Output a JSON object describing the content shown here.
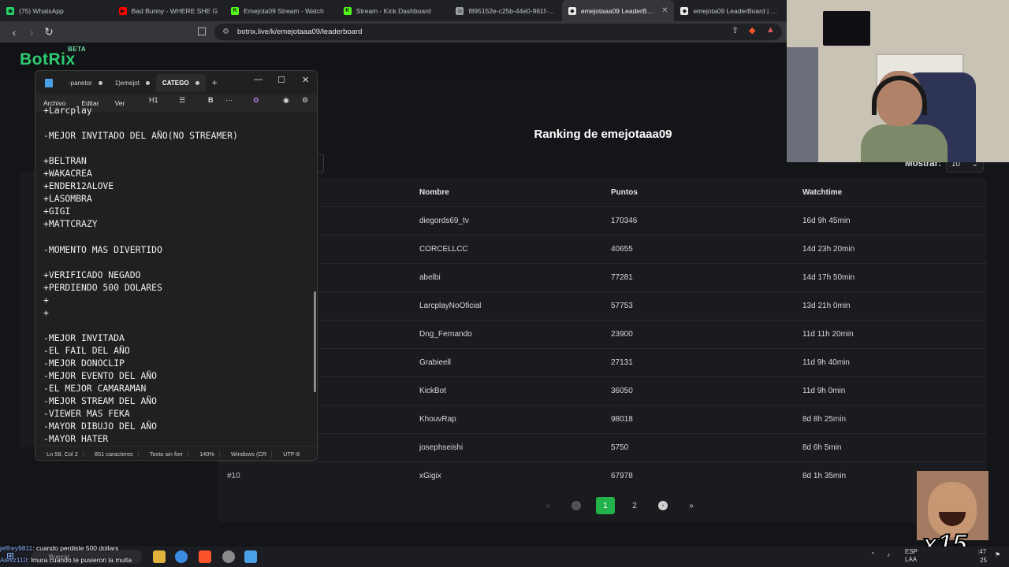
{
  "browser": {
    "tabs": [
      {
        "title": "(75) WhatsApp",
        "icon": "whatsapp-icon",
        "color": "#25d366",
        "glyph": "◉"
      },
      {
        "title": "Bad Bunny - WHERE SHE G",
        "icon": "youtube-icon",
        "color": "#ff0000",
        "glyph": "▶"
      },
      {
        "title": "Emejota09 Stream - Watch",
        "icon": "kick-icon",
        "color": "#53fc18",
        "glyph": "K"
      },
      {
        "title": "Stream - Kick Dashboard",
        "icon": "kick-icon",
        "color": "#53fc18",
        "glyph": "K"
      },
      {
        "title": "f895152e-c25b-44e0-961f-322",
        "icon": "globe-icon",
        "color": "#9aa0a6",
        "glyph": "◎"
      },
      {
        "title": "emejotaaa09 LeaderBoard",
        "icon": "botrix-icon",
        "color": "#e8e8e8",
        "glyph": "◆",
        "active": true
      },
      {
        "title": "emejota09 LeaderBoard | The",
        "icon": "botrix-icon",
        "color": "#e8e8e8",
        "glyph": "◆"
      }
    ],
    "url": "botrix.live/k/emejotaaa09/leaderboard"
  },
  "site": {
    "logo": "BotRix",
    "beta": "BETA",
    "ranking_title": "Ranking de emejotaaa09",
    "show_label": "Mostrar:",
    "show_value": "10",
    "columns": {
      "name": "Nombre",
      "points": "Puntos",
      "watchtime": "Watchtime"
    },
    "rows": [
      {
        "rank": "",
        "name": "diegords69_tv",
        "points": "170346",
        "watchtime": "16d 9h 45min"
      },
      {
        "rank": "",
        "name": "CORCELLCC",
        "points": "40655",
        "watchtime": "14d 23h 20min"
      },
      {
        "rank": "",
        "name": "abelbi",
        "points": "77281",
        "watchtime": "14d 17h 50min"
      },
      {
        "rank": "",
        "name": "LarcplayNoOficial",
        "points": "57753",
        "watchtime": "13d 21h 0min"
      },
      {
        "rank": "",
        "name": "Dng_Fernando",
        "points": "23900",
        "watchtime": "11d 11h 20min"
      },
      {
        "rank": "",
        "name": "Grabieell",
        "points": "27131",
        "watchtime": "11d 9h 40min"
      },
      {
        "rank": "",
        "name": "KickBot",
        "points": "36050",
        "watchtime": "11d 9h 0min"
      },
      {
        "rank": "",
        "name": "KhouvRap",
        "points": "98018",
        "watchtime": "8d 8h 25min"
      },
      {
        "rank": "",
        "name": "josephseishi",
        "points": "5750",
        "watchtime": "8d 6h 5min"
      },
      {
        "rank": "#10",
        "name": "xGigix",
        "points": "67978",
        "watchtime": "8d 1h 35min"
      }
    ],
    "pagination": {
      "first": "«",
      "prev": "‹",
      "page1": "1",
      "page2": "2",
      "next": "›",
      "last": "»"
    }
  },
  "notepad": {
    "tabs": [
      "-panetor",
      "1)emejot",
      "CATEGO"
    ],
    "menu": [
      "Archivo",
      "Editar",
      "Ver"
    ],
    "heading": "H1",
    "bold": "B",
    "more": "···",
    "text": "+Larcplay\n\n-MEJOR INVITADO DEL AÑO(NO STREAMER)\n\n+BELTRAN\n+WAKACREA\n+ENDER12ALOVE\n+LASOMBRA\n+GIGI\n+MATTCRAZY\n\n-MOMENTO MAS DIVERTIDO\n\n+VERIFICADO NEGADO\n+PERDIENDO 500 DOLARES\n+\n+\n\n-MEJOR INVITADA\n-EL FAIL DEL AÑO\n-MEJOR DONOCLIP\n-MEJOR EVENTO DEL AÑO\n-EL MEJOR CAMARAMAN\n-MEJOR STREAM DEL AÑO\n-VIEWER MAS FEKA\n-MAYOR DIBUJO DEL AÑO\n-MAYOR HATER",
    "status": {
      "position": "Ln 58, Col 2",
      "chars": "851 caracteres",
      "format": "Texto sin forr",
      "zoom": "140%",
      "eol": "Windows (CR",
      "encoding": "UTF-8"
    }
  },
  "chat": [
    {
      "user": "jeffrey9811",
      "msg": ": cuando perdiste 500 dollars"
    },
    {
      "user": "Alexz110",
      "msg": ": lmura cuando te pusieron la multa"
    }
  ],
  "overlay": {
    "multiplier": "x15"
  },
  "taskbar": {
    "search": "Buscar",
    "lang1": "ESP",
    "lang2": "LAA",
    "time": ":47",
    "date": "25"
  }
}
